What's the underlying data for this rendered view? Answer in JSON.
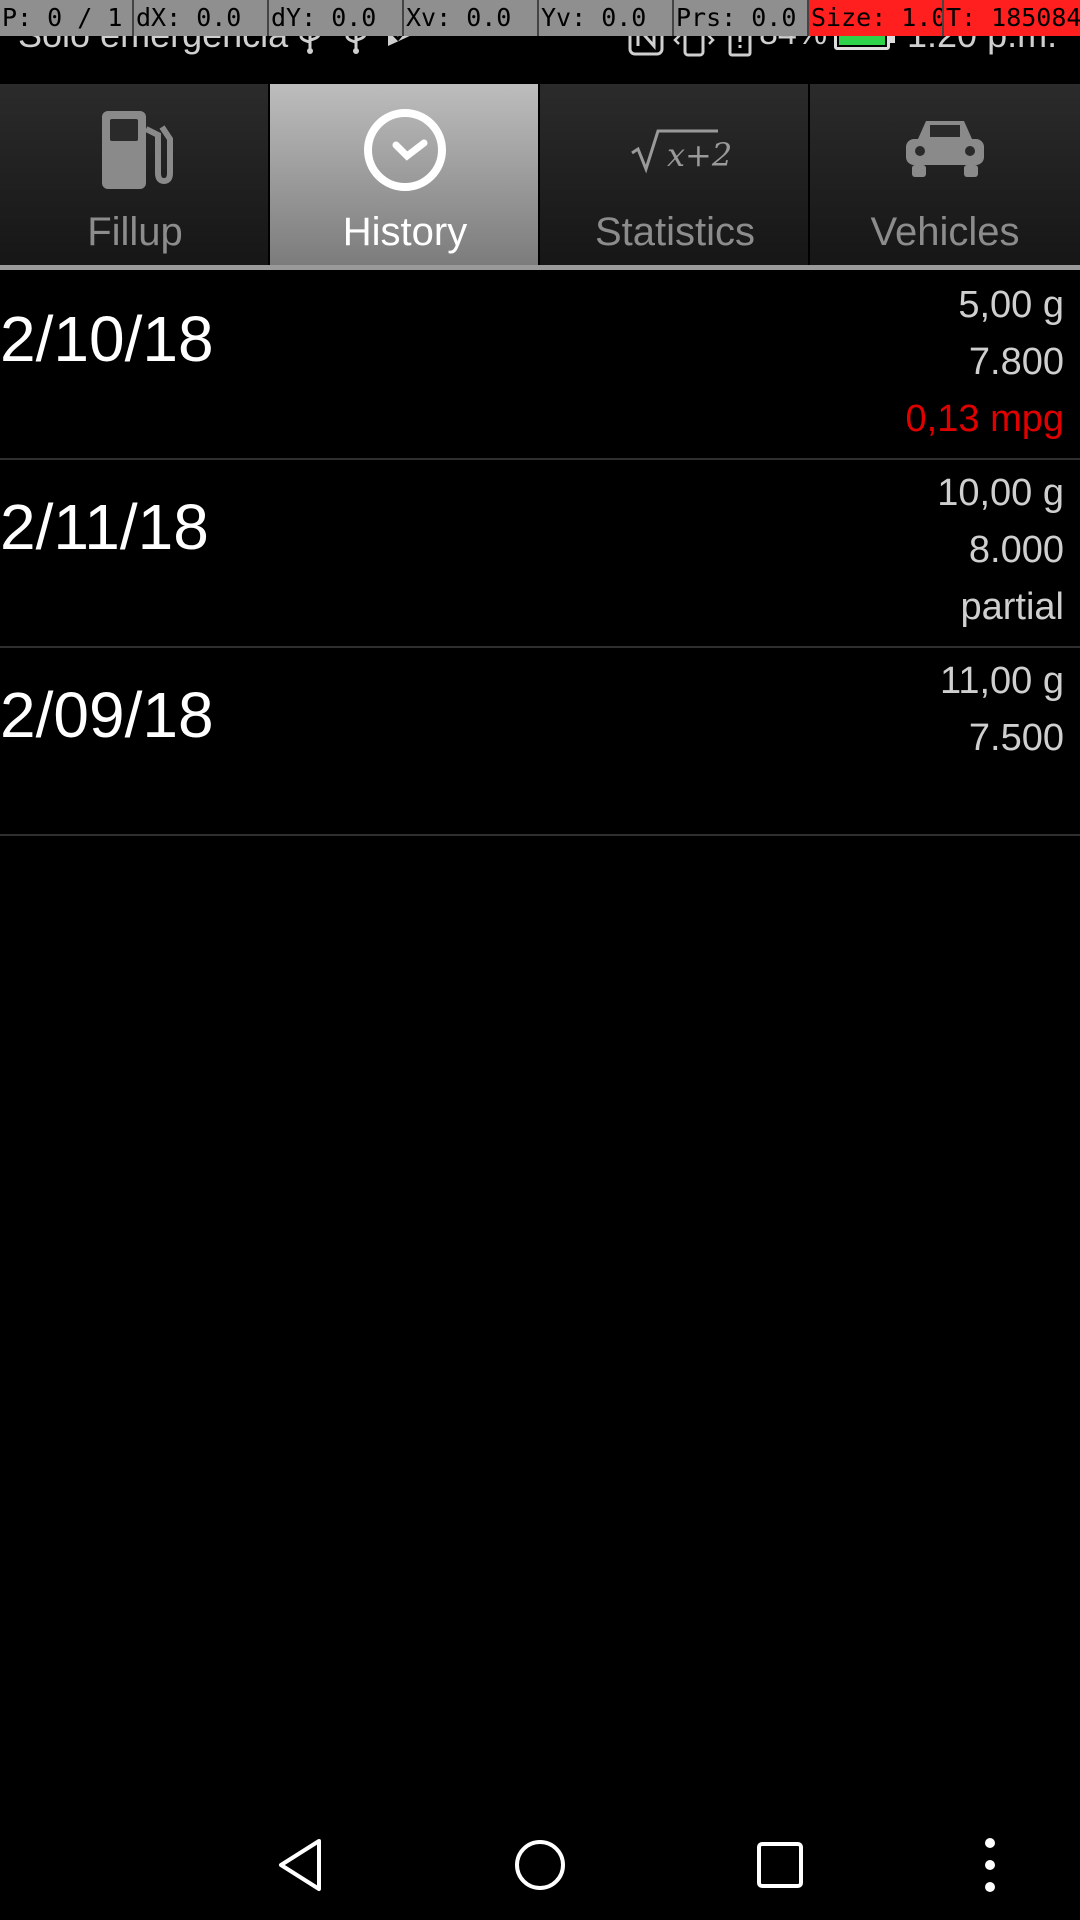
{
  "debug_bar": {
    "cells": [
      {
        "text": "P: 0 / 1",
        "red": false
      },
      {
        "text": "dX: 0.0",
        "red": false
      },
      {
        "text": "dY: 0.0",
        "red": false
      },
      {
        "text": "Xv: 0.0",
        "red": false
      },
      {
        "text": "Yv: 0.0",
        "red": false
      },
      {
        "text": "Prs: 0.0",
        "red": false
      },
      {
        "text": "Size: 1.0",
        "red": true
      },
      {
        "text": "T: 185084",
        "red": true
      }
    ]
  },
  "status_bar": {
    "carrier": "Solo emergencia",
    "battery_percent": "84%",
    "clock": "1:20 p.m."
  },
  "tabs": [
    {
      "label": "Fillup",
      "icon": "fuel-pump-icon",
      "active": false
    },
    {
      "label": "History",
      "icon": "clock-icon",
      "active": true
    },
    {
      "label": "Statistics",
      "icon": "sqrt-icon",
      "active": false
    },
    {
      "label": "Vehicles",
      "icon": "car-icon",
      "active": false
    }
  ],
  "statistics_icon_text": "x+2",
  "history": [
    {
      "date": "2/10/18",
      "amount": "5,00 g",
      "odometer": "7.800",
      "note": "0,13 mpg",
      "note_color": "#e00000"
    },
    {
      "date": "2/11/18",
      "amount": "10,00 g",
      "odometer": "8.000",
      "note": "partial",
      "note_color": "#cfcfcf"
    },
    {
      "date": "2/09/18",
      "amount": "11,00 g",
      "odometer": "7.500",
      "note": "",
      "note_color": "#cfcfcf"
    }
  ],
  "nav": {
    "back_icon": "back-triangle-icon",
    "home_icon": "home-circle-icon",
    "recents_icon": "recents-square-icon",
    "menu_icon": "overflow-menu-icon"
  }
}
